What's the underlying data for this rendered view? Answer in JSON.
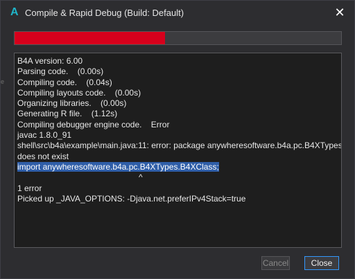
{
  "window": {
    "title": "Compile & Rapid Debug (Build: Default)",
    "app_icon_glyph": "A",
    "close_glyph": "✕",
    "edge_glyphs": [
      "s",
      "e"
    ]
  },
  "progress": {
    "fraction": 0.46,
    "fill_color": "#d6001c"
  },
  "log": {
    "lines": [
      "B4A version: 6.00",
      "Parsing code.    (0.00s)",
      "Compiling code.    (0.04s)",
      "Compiling layouts code.    (0.00s)",
      "Organizing libraries.    (0.00s)",
      "Generating R file.    (1.12s)",
      "Compiling debugger engine code.    Error",
      "javac 1.8.0_91",
      "shell\\src\\b4a\\example\\main.java:11: error: package anywheresoftware.b4a.pc.B4XTypes",
      "does not exist",
      "import anywheresoftware.b4a.pc.B4XTypes.B4XClass;",
      "^",
      "1 error",
      "Picked up _JAVA_OPTIONS: -Djava.net.preferIPv4Stack=true"
    ]
  },
  "buttons": {
    "cancel_label": "Cancel",
    "close_label": "Close"
  },
  "colors": {
    "accent": "#3399ff",
    "selection": "#2f5ea8",
    "error_bar": "#d6001c"
  }
}
